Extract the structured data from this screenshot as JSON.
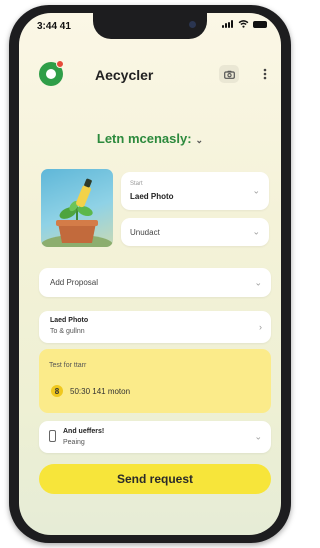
{
  "status_bar": {
    "time": "3:44 41"
  },
  "header": {
    "app_name": "Aecycler",
    "icons": [
      "app-logo-icon",
      "camera-icon",
      "more-icon"
    ]
  },
  "section": {
    "title": "Letn mcenasly:",
    "chevron": "⌄"
  },
  "form": {
    "photo_select": {
      "caption": "Start",
      "value": "Laed Photo"
    },
    "type_select": {
      "value": "Unudact"
    },
    "add_proposal": {
      "label": "Add Proposal"
    },
    "photo_row": {
      "title": "Laed Photo",
      "subtitle": "To & gullnn"
    },
    "info_card": {
      "label": "Test for ttarr",
      "badge": "8",
      "value": "50:30 141 moton"
    },
    "notify_row": {
      "title": "And ueffers!",
      "subtitle": "Peaing"
    }
  },
  "actions": {
    "send_label": "Send request"
  },
  "colors": {
    "brand_green": "#2f9e48",
    "accent_yellow": "#f7e53a",
    "card_yellow": "#fbeb8a"
  }
}
